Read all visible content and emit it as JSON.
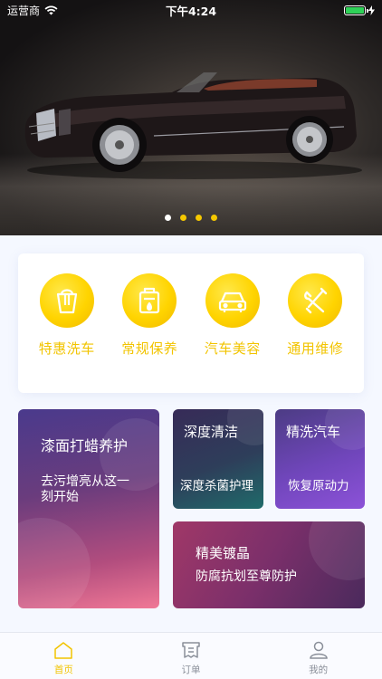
{
  "status_bar": {
    "carrier": "运营商",
    "time": "下午4:24",
    "battery_level": 1.0
  },
  "banner": {
    "slide_count": 4,
    "active_index": 0
  },
  "services": [
    {
      "label": "特惠洗车",
      "icon": "bucket-icon"
    },
    {
      "label": "常规保养",
      "icon": "oil-can-icon"
    },
    {
      "label": "汽车美容",
      "icon": "car-front-icon"
    },
    {
      "label": "通用维修",
      "icon": "wrench-screwdriver-icon"
    }
  ],
  "promos": {
    "paint": {
      "title": "漆面打蜡养护",
      "subtitle": "去污增亮从这一刻开始"
    },
    "deep_clean": {
      "title": "深度清洁",
      "subtitle": "深度杀菌护理"
    },
    "fine_wash": {
      "title": "精洗汽车",
      "subtitle": "恢复原动力"
    },
    "coating": {
      "title": "精美镀晶",
      "subtitle": "防腐抗划至尊防护"
    }
  },
  "tabbar": [
    {
      "label": "首页",
      "icon": "home-icon",
      "active": true
    },
    {
      "label": "订单",
      "icon": "receipt-icon",
      "active": false
    },
    {
      "label": "我的",
      "icon": "user-icon",
      "active": false
    }
  ],
  "colors": {
    "accent": "#f2c400",
    "background": "#f5f8ff"
  }
}
